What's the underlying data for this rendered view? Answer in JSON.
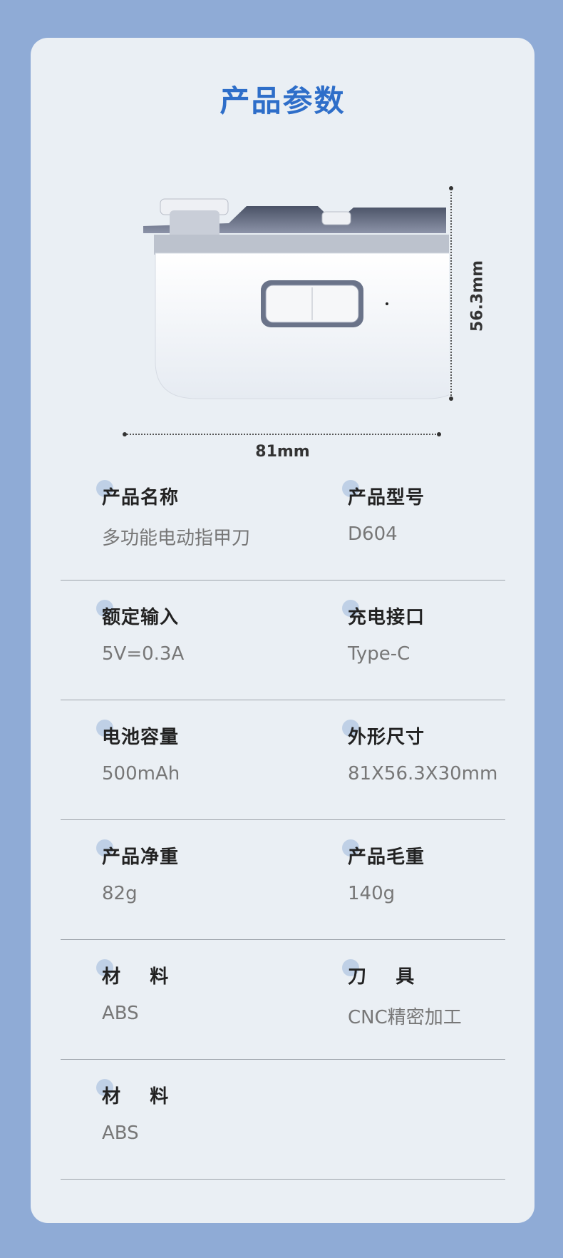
{
  "header": {
    "title": "产品参数"
  },
  "dimensions": {
    "width": "81mm",
    "height": "56.3mm"
  },
  "specs": [
    {
      "left": {
        "label": "产品名称",
        "value": "多功能电动指甲刀"
      },
      "right": {
        "label": "产品型号",
        "value": "D604"
      }
    },
    {
      "left": {
        "label": "额定输入",
        "value": "5V=0.3A"
      },
      "right": {
        "label": "充电接口",
        "value": "Type-C"
      }
    },
    {
      "left": {
        "label": "电池容量",
        "value": "500mAh"
      },
      "right": {
        "label": "外形尺寸",
        "value": "81X56.3X30mm"
      }
    },
    {
      "left": {
        "label": "产品净重",
        "value": "82g"
      },
      "right": {
        "label": "产品毛重",
        "value": "140g"
      }
    },
    {
      "left": {
        "label": "材    料",
        "value": "ABS"
      },
      "right": {
        "label": "刀    具",
        "value": "CNC精密加工"
      }
    },
    {
      "left": {
        "label": "材    料",
        "value": "ABS"
      }
    }
  ]
}
